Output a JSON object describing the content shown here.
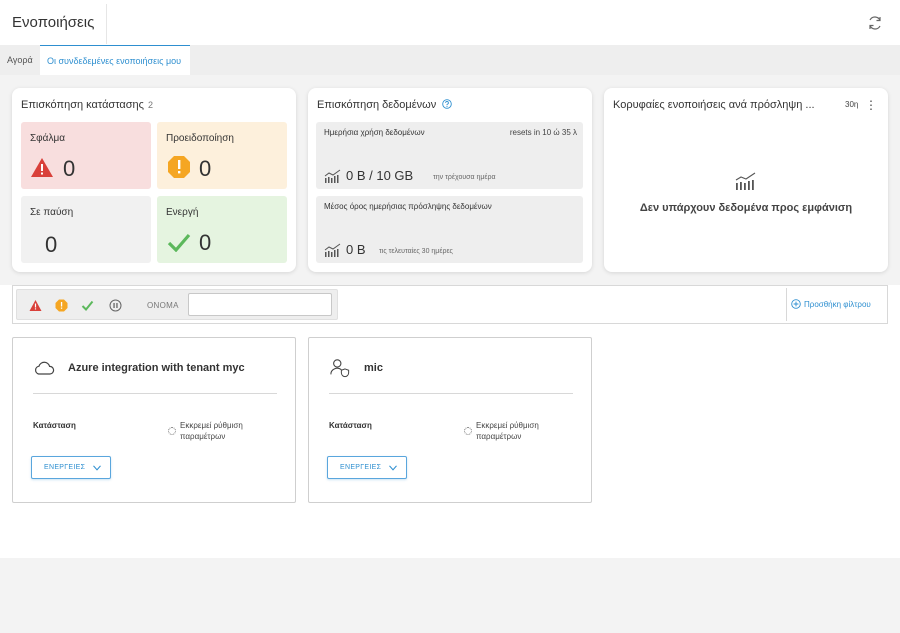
{
  "header": {
    "title": "Ενοποιήσεις"
  },
  "tabs": [
    {
      "label": "Αγορά",
      "active": false
    },
    {
      "label": "Οι συνδεδεμένες ενοποιήσεις μου",
      "active": true
    }
  ],
  "status_overview": {
    "title": "Επισκόπηση κατάστασης",
    "count": "2",
    "tiles": {
      "error": {
        "label": "Σφάλμα",
        "value": "0",
        "color": "#d9403a"
      },
      "warning": {
        "label": "Προειδοποίηση",
        "value": "0",
        "color": "#f5a623"
      },
      "paused": {
        "label": "Σε παύση",
        "value": "0"
      },
      "active": {
        "label": "Ενεργή",
        "value": "0",
        "color": "#5cb85c"
      }
    }
  },
  "data_overview": {
    "title": "Επισκόπηση δεδομένων",
    "daily": {
      "label": "Ημερήσια χρήση δεδομένων",
      "reset": "resets in 10 ώ 35 λ",
      "value": "0 B / 10 GB",
      "sub": "την τρέχουσα ημέρα"
    },
    "average": {
      "label": "Μέσος όρος ημερήσιας πρόσληψης δεδομένων",
      "value": "0 B",
      "sub": "τις τελευταίες 30 ημέρες"
    }
  },
  "top_integrations": {
    "title": "Κορυφαίες ενοποιήσεις ανά πρόσληψη ...",
    "period": "30η",
    "empty": "Δεν υπάρχουν δεδομένα προς εμφάνιση"
  },
  "filters": {
    "name_label": "ΟΝΟΜΑ",
    "name_value": "",
    "add_filter": "Προσθήκη φίλτρου"
  },
  "integrations": [
    {
      "name": "Azure integration with tenant myc",
      "icon": "cloud-icon",
      "status_label": "Κατάσταση",
      "status": "Εκκρεμεί ρύθμιση παραμέτρων",
      "actions": "ΕΝΕΡΓΕΙΕΣ"
    },
    {
      "name": "mic",
      "icon": "user-shield-icon",
      "status_label": "Κατάσταση",
      "status": "Εκκρεμεί ρύθμιση παραμέτρων",
      "actions": "ΕΝΕΡΓΕΙΕΣ"
    }
  ],
  "colors": {
    "accent": "#2e8fd0",
    "error_bg": "#f8dede",
    "warning_bg": "#fdf0dc",
    "active_bg": "#e5f4e0",
    "paused_bg": "#f1f1f1"
  }
}
